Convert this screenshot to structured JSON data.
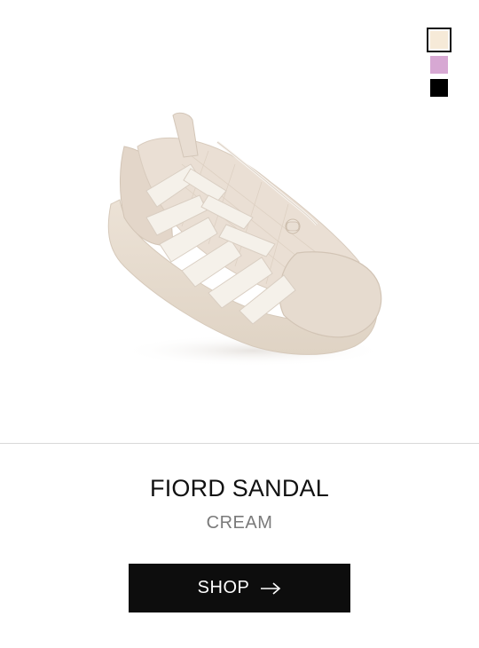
{
  "product": {
    "name": "FIORD SANDAL",
    "color_name": "CREAM",
    "image_alt": "shoe-image"
  },
  "swatches": [
    {
      "name": "cream",
      "color": "#f6ead8",
      "selected": true
    },
    {
      "name": "lavender",
      "color": "#d7a8d3",
      "selected": false
    },
    {
      "name": "black",
      "color": "#000000",
      "selected": false
    }
  ],
  "cta": {
    "label": "SHOP",
    "icon": "arrow-right-icon"
  }
}
